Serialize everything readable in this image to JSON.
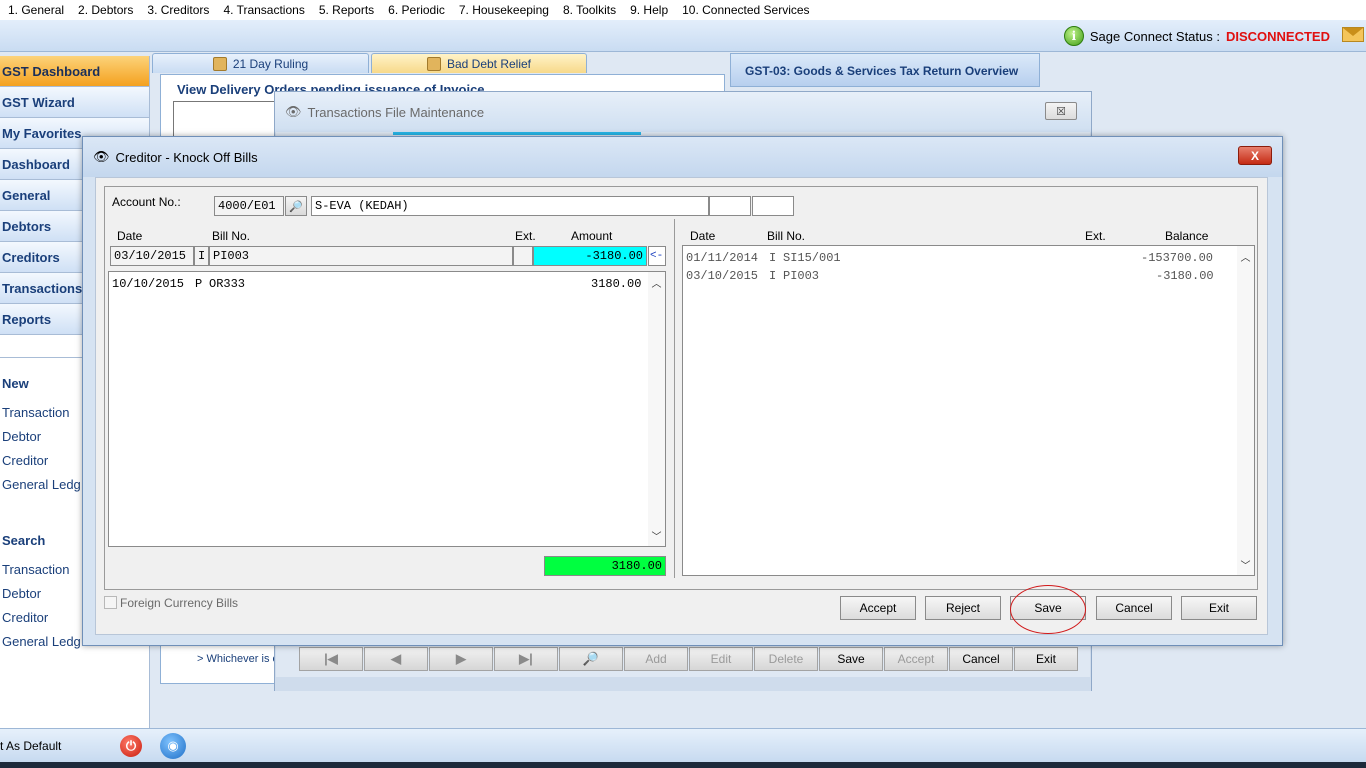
{
  "menu": [
    "1. General",
    "2. Debtors",
    "3. Creditors",
    "4. Transactions",
    "5. Reports",
    "6. Periodic",
    "7. Housekeeping",
    "8. Toolkits",
    "9. Help",
    "10. Connected Services"
  ],
  "top_status": {
    "label": "Sage Connect Status :",
    "value": "DISCONNECTED",
    "value_color": "#e01010"
  },
  "sidebar": {
    "buttons": [
      "GST Dashboard",
      "GST Wizard",
      "My Favorites",
      "Dashboard",
      "General",
      "Debtors",
      "Creditors",
      "Transactions",
      "Reports"
    ],
    "new_head": "New",
    "new_links": [
      "Transaction",
      "Debtor",
      "Creditor",
      "General Ledg"
    ],
    "search_head": "Search",
    "search_links": [
      "Transaction",
      "Debtor",
      "Creditor",
      "General Ledg"
    ],
    "bottom_label": "t As Default"
  },
  "background": {
    "tab_ruling": "21 Day Ruling",
    "tab_baddebt": "Bad Debt Relief",
    "gst_panel": "GST-03: Goods & Services Tax Return Overview",
    "delivery_title": "View Delivery Orders pending issuance of Invoice",
    "whichever": "> Whichever is e"
  },
  "tfm": {
    "title": "Transactions File Maintenance",
    "close": "☒",
    "toolbar": {
      "nav": [
        "|◀",
        "◀",
        "▶",
        "▶|",
        "🔎"
      ],
      "add": "Add",
      "edit": "Edit",
      "delete": "Delete",
      "save": "Save",
      "accept": "Accept",
      "cancel": "Cancel",
      "exit": "Exit"
    }
  },
  "ko": {
    "title": "Creditor - Knock Off Bills",
    "close": "X",
    "account_label": "Account No.:",
    "account_no": "4000/E01",
    "account_name": "S-EVA (KEDAH)",
    "left": {
      "headers": {
        "date": "Date",
        "bill": "Bill No.",
        "ext": "Ext.",
        "amount": "Amount"
      },
      "current": {
        "date": "03/10/2015",
        "type": "I",
        "bill": "PI003",
        "amount": "-3180.00",
        "arrow": "<-"
      },
      "rows": [
        {
          "date": "10/10/2015",
          "type": "P",
          "bill": "OR333",
          "amount": "3180.00"
        }
      ],
      "total": "3180.00"
    },
    "right": {
      "headers": {
        "date": "Date",
        "bill": "Bill No.",
        "ext": "Ext.",
        "balance": "Balance"
      },
      "rows": [
        {
          "date": "01/11/2014",
          "type": "I",
          "bill": "SI15/001",
          "balance": "-153700.00"
        },
        {
          "date": "03/10/2015",
          "type": "I",
          "bill": "PI003",
          "balance": "-3180.00"
        }
      ]
    },
    "foreign_currency": "Foreign Currency Bills",
    "buttons": {
      "accept": "Accept",
      "reject": "Reject",
      "save": "Save",
      "cancel": "Cancel",
      "exit": "Exit"
    },
    "colors": {
      "amount_bg": "#00ffff",
      "total_bg": "#00ff40",
      "highlight": "#d0191a"
    }
  }
}
